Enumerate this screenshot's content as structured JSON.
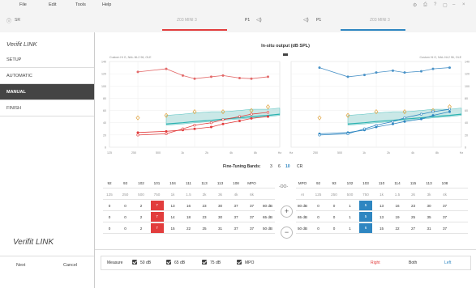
{
  "menu": {
    "file": "File",
    "edit": "Edit",
    "tools": "Tools",
    "help": "Help"
  },
  "titlebar": {
    "patient_id": "SR",
    "left_device": "Z03 MINI 3",
    "left_program": "P1",
    "right_program": "P1",
    "right_device": "Z03 MINI 3"
  },
  "sidebar": {
    "logo": "Verifit LINK",
    "items": [
      "SETUP",
      "AUTOMATIC",
      "MANUAL",
      "FINISH"
    ],
    "active": "MANUAL",
    "brand": "Verifit LINK",
    "next": "Next",
    "cancel": "Cancel"
  },
  "chart": {
    "title": "In-situ output (dB SPL)",
    "left_note": "Custom Hi G, NAL-NL2 96, OLE",
    "right_note": "Custom Hi G, NAL-NL2 96, OLE",
    "yticks": [
      "140",
      "120",
      "100",
      "80",
      "60",
      "40",
      "20",
      "0"
    ],
    "xticks_left": [
      "125",
      "250",
      "500",
      "1k",
      "2k",
      "4k",
      "8k",
      "Hz"
    ],
    "xticks_right": [
      "Hz",
      "250",
      "500",
      "1k",
      "2k",
      "4k",
      "8k",
      "Hz"
    ]
  },
  "chart_data": {
    "type": "line",
    "x_hz": [
      250,
      500,
      750,
      1000,
      1500,
      2000,
      3000,
      4000,
      6000
    ],
    "left_mpo": [
      123,
      128,
      117,
      112,
      115,
      117,
      113,
      112,
      115
    ],
    "left_curve_50": [
      24,
      26,
      28,
      30,
      33,
      38,
      43,
      47,
      50
    ],
    "left_curve_65": [
      20,
      22,
      30,
      36,
      40,
      45,
      50,
      54,
      57
    ],
    "right_mpo": [
      130,
      115,
      118,
      122,
      125,
      122,
      124,
      128,
      130
    ],
    "right_curve_50": [
      22,
      24,
      28,
      33,
      38,
      42,
      46,
      52,
      58
    ],
    "right_curve_65": [
      20,
      22,
      30,
      36,
      42,
      48,
      54,
      58,
      62
    ],
    "ylim": [
      0,
      140
    ]
  },
  "bands": {
    "label": "Fine-Tuning Bands:",
    "options": [
      "3",
      "6",
      "10",
      "CR"
    ],
    "active": "10"
  },
  "table": {
    "left": {
      "mpo": [
        "92",
        "93",
        "102",
        "101",
        "104",
        "111",
        "113",
        "113",
        "108",
        "MPO"
      ],
      "freq": [
        "125",
        "250",
        "500",
        "750",
        "1k",
        "1.5",
        "2k",
        "3k",
        "4k",
        "6k"
      ],
      "rows": [
        [
          "0",
          "0",
          "2",
          "7",
          "13",
          "16",
          "23",
          "30",
          "37",
          "37",
          "80 dB"
        ],
        [
          "0",
          "0",
          "2",
          "7",
          "14",
          "18",
          "23",
          "30",
          "37",
          "37",
          "65 dB"
        ],
        [
          "0",
          "0",
          "2",
          "7",
          "15",
          "22",
          "25",
          "31",
          "37",
          "37",
          "50 dB"
        ]
      ]
    },
    "right": {
      "mpo": [
        "MPO",
        "92",
        "93",
        "102",
        "103",
        "110",
        "114",
        "115",
        "113",
        "108"
      ],
      "freq": [
        "AI",
        "125",
        "250",
        "500",
        "750",
        "1k",
        "1.5",
        "2k",
        "3k",
        "4k"
      ],
      "rows": [
        [
          "80 dB",
          "0",
          "0",
          "1",
          "5",
          "13",
          "16",
          "23",
          "30",
          "37"
        ],
        [
          "65 dB",
          "0",
          "0",
          "1",
          "5",
          "13",
          "19",
          "25",
          "35",
          "37"
        ],
        [
          "50 dB",
          "0",
          "0",
          "1",
          "6",
          "15",
          "22",
          "27",
          "31",
          "37"
        ]
      ]
    },
    "link": "-OO-"
  },
  "bottom": {
    "measure": "Measure",
    "c1": "50 dB",
    "c2": "65 dB",
    "c3": "75 dB",
    "c4": "MPO",
    "right": "Right",
    "both": "Both",
    "left": "Left"
  },
  "colors": {
    "red": "#e23d3d",
    "blue": "#2e86c1",
    "teal": "#2bb3b1"
  }
}
